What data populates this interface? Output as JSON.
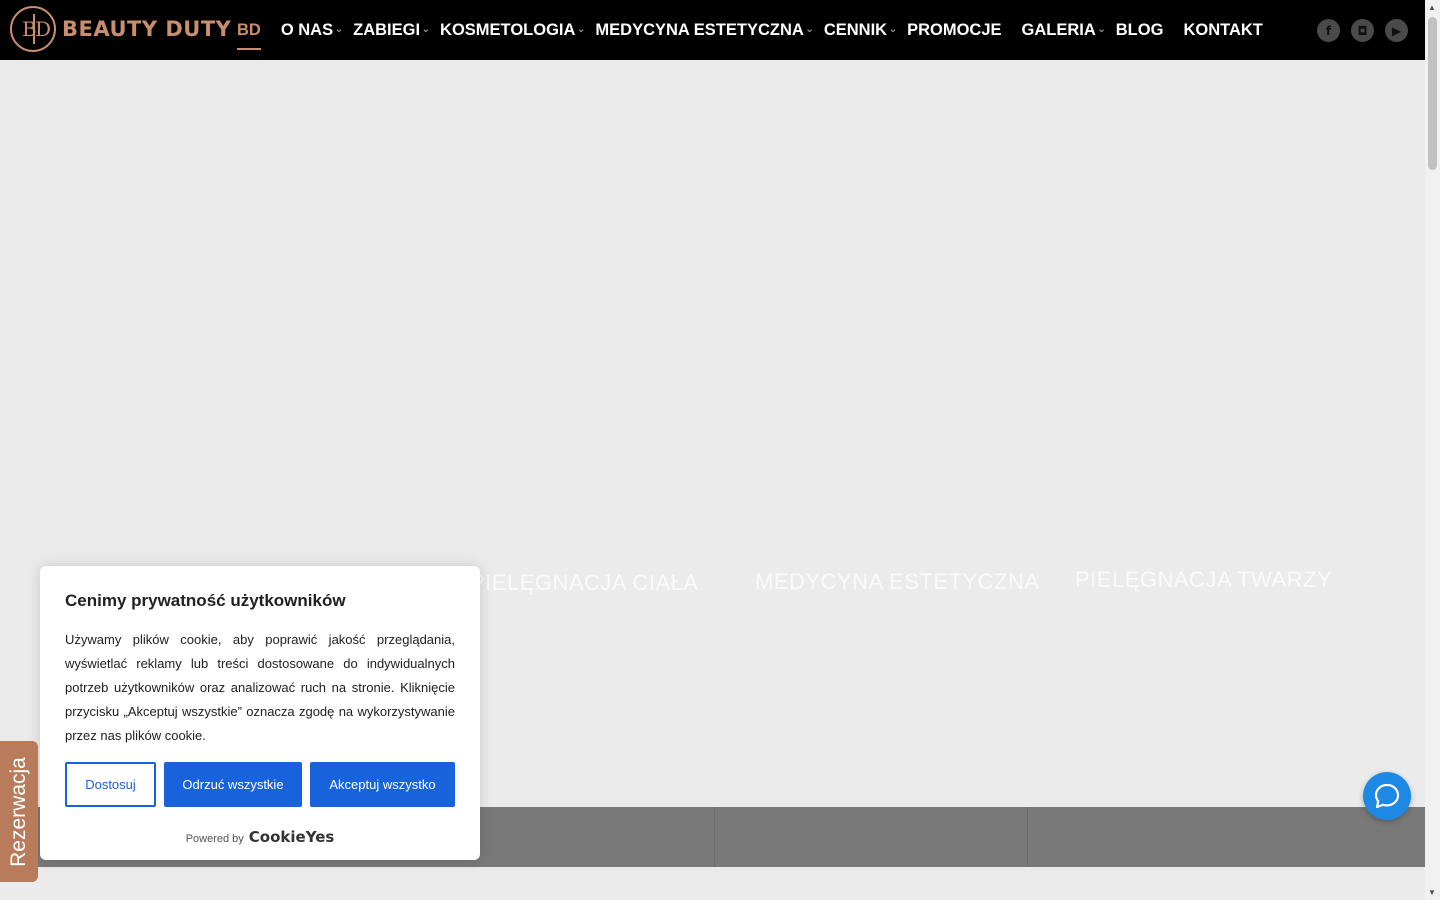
{
  "brand": {
    "logo_letters_left": "B",
    "logo_letters_right": "D",
    "name": "BEAUTY DUTY",
    "accent_color": "#c98e6e"
  },
  "nav": {
    "items": [
      {
        "label": "BD",
        "active": true,
        "has_dropdown": false
      },
      {
        "label": "O NAS",
        "active": false,
        "has_dropdown": true
      },
      {
        "label": "ZABIEGI",
        "active": false,
        "has_dropdown": true
      },
      {
        "label": "KOSMETOLOGIA",
        "active": false,
        "has_dropdown": true
      },
      {
        "label": "MEDYCYNA ESTETYCZNA",
        "active": false,
        "has_dropdown": true
      },
      {
        "label": "CENNIK",
        "active": false,
        "has_dropdown": true
      },
      {
        "label": "PROMOCJE",
        "active": false,
        "has_dropdown": false
      },
      {
        "label": "GALERIA",
        "active": false,
        "has_dropdown": true
      },
      {
        "label": "BLOG",
        "active": false,
        "has_dropdown": false
      },
      {
        "label": "KONTAKT",
        "active": false,
        "has_dropdown": false
      }
    ]
  },
  "social": {
    "facebook": "f",
    "instagram": "◘",
    "youtube": "▶"
  },
  "hero": {
    "tiles": [
      {
        "label": "PIELĘGNACJA CIAŁA"
      },
      {
        "label": "MEDYCYNA ESTETYCZNA"
      },
      {
        "label": "PIELĘGNACJA TWARZY"
      }
    ]
  },
  "cookie_banner": {
    "title": "Cenimy prywatność użytkowników",
    "text": "Używamy plików cookie, aby poprawić jakość przeglądania, wyświetlać reklamy lub treści dostosowane do indywidualnych potrzeb użytkowników oraz analizować ruch na stronie. Kliknięcie przycisku „Akceptuj wszystkie” oznacza zgodę na wykorzystywanie przez nas plików cookie.",
    "customize_label": "Dostosuj",
    "reject_label": "Odrzuć wszystkie",
    "accept_label": "Akceptuj wszystko",
    "powered_by": "Powered by",
    "powered_brand": "CookieYes",
    "button_color": "#1863dc"
  },
  "reservation_tab": {
    "label": "Rezerwacja",
    "color": "#b87b5c"
  },
  "chat_button": {
    "icon": "chat-bubble-icon",
    "color": "#1e88e5"
  }
}
